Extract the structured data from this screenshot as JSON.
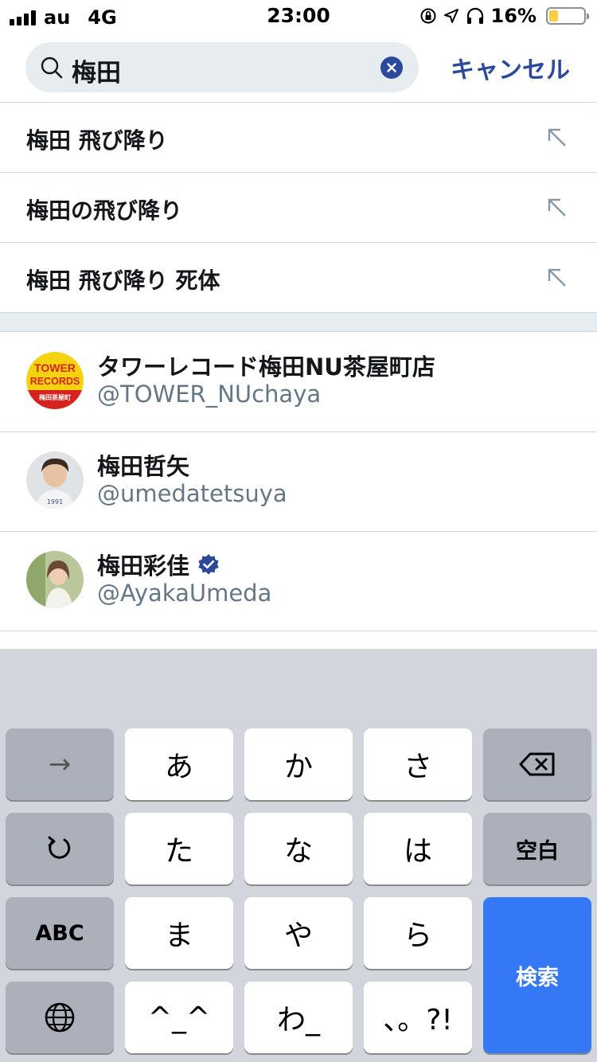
{
  "status_bar": {
    "carrier": "au",
    "network": "4G",
    "time": "23:00",
    "battery_percent": "16%",
    "battery_level": 0.16
  },
  "search": {
    "query": "梅田",
    "cancel_label": "キャンセル"
  },
  "suggestions": [
    {
      "text": "梅田 飛び降り"
    },
    {
      "text": "梅田の飛び降り"
    },
    {
      "text": "梅田 飛び降り 死体"
    }
  ],
  "users": [
    {
      "name": "タワーレコード梅田NU茶屋町店",
      "handle": "@TOWER_NUchaya",
      "verified": false,
      "avatar_logo_lines": [
        "TOWER",
        "RECORDS",
        "梅田茶屋町"
      ]
    },
    {
      "name": "梅田哲矢",
      "handle": "@umedatetsuya",
      "verified": false
    },
    {
      "name": "梅田彩佳",
      "handle": "@AyakaUmeda",
      "verified": true
    }
  ],
  "keyboard": {
    "arrow_key": "→",
    "undo_icon": "undo-icon",
    "abc_key": "ABC",
    "globe_icon": "globe-icon",
    "row1": [
      "あ",
      "か",
      "さ"
    ],
    "row2": [
      "た",
      "な",
      "は"
    ],
    "row3": [
      "ま",
      "や",
      "ら"
    ],
    "row4": [
      "^_^",
      "わ_",
      "、。?!"
    ],
    "space_key": "空白",
    "search_key": "検索",
    "delete_icon": "backspace-icon"
  },
  "colors": {
    "accent": "#2b4a9b",
    "search_key": "#3478f6",
    "battery": "#f7ce46"
  }
}
